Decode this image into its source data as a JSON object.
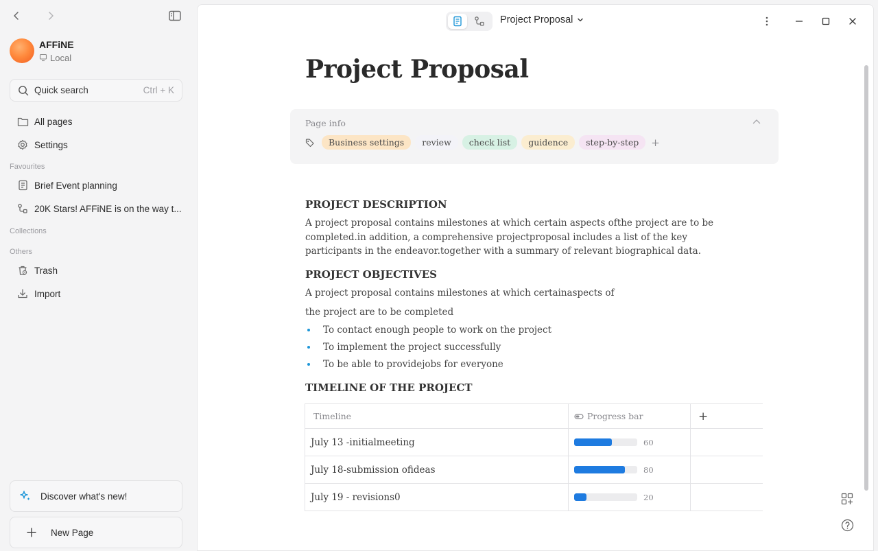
{
  "sidebar": {
    "workspace_name": "AFFiNE",
    "workspace_location": "Local",
    "search_label": "Quick search",
    "search_shortcut": "Ctrl + K",
    "nav": [
      {
        "label": "All pages",
        "icon": "folder-icon"
      },
      {
        "label": "Settings",
        "icon": "gear-icon"
      }
    ],
    "favourites_heading": "Favourites",
    "favourites": [
      {
        "label": "Brief Event planning",
        "icon": "page-icon"
      },
      {
        "label": "20K Stars! AFFiNE is on the way t...",
        "icon": "edgeless-icon"
      }
    ],
    "collections_heading": "Collections",
    "others_heading": "Others",
    "others": [
      {
        "label": "Trash",
        "icon": "trash-icon"
      },
      {
        "label": "Import",
        "icon": "import-icon"
      }
    ],
    "discover_label": "Discover what's new!",
    "new_page_label": "New Page"
  },
  "header": {
    "doc_title": "Project Proposal",
    "mode_active": "page"
  },
  "doc": {
    "title": "Project Proposal",
    "page_info_label": "Page info",
    "tags": [
      {
        "label": "Business settings",
        "color": "#fce5c5"
      },
      {
        "label": "review",
        "color": "#efeff6"
      },
      {
        "label": "check list",
        "color": "#d7f1e4"
      },
      {
        "label": "guidence",
        "color": "#fbedd0"
      },
      {
        "label": "step-by-step",
        "color": "#f5e4f3"
      }
    ],
    "add_tag": "+",
    "section1_heading": "PROJECT DESCRIPTION",
    "section1_body": "A project proposal contains milestones at which certain aspects ofthe project are to be completed.in addition, a comprehensive projectproposal includes a list of the key participants in the endeavor.together with a summary of relevant biographical data.",
    "section2_heading": "PROJECT OBJECTIVES",
    "section2_line1": "A project proposal contains milestones at which certainaspects of",
    "section2_line2": "the project are to be completed",
    "bullets": [
      "To contact enough people to work on the project",
      "To implement the project successfully",
      "To be able to providejobs for everyone"
    ],
    "section3_heading": "TIMELINE OF THE PROJECT",
    "table": {
      "col_timeline": "Timeline",
      "col_progress": "Progress bar",
      "add_col": "+",
      "rows": [
        {
          "timeline": "July 13 -initialmeeting",
          "progress": 60
        },
        {
          "timeline": "July 18-submission ofideas",
          "progress": 80
        },
        {
          "timeline": "July 19 - revisions0",
          "progress": 20
        }
      ]
    }
  },
  "colors": {
    "progress_fill": "#1e7be0",
    "bullet": "#1e96d8",
    "accent_sparkle": "#1e96d8"
  }
}
